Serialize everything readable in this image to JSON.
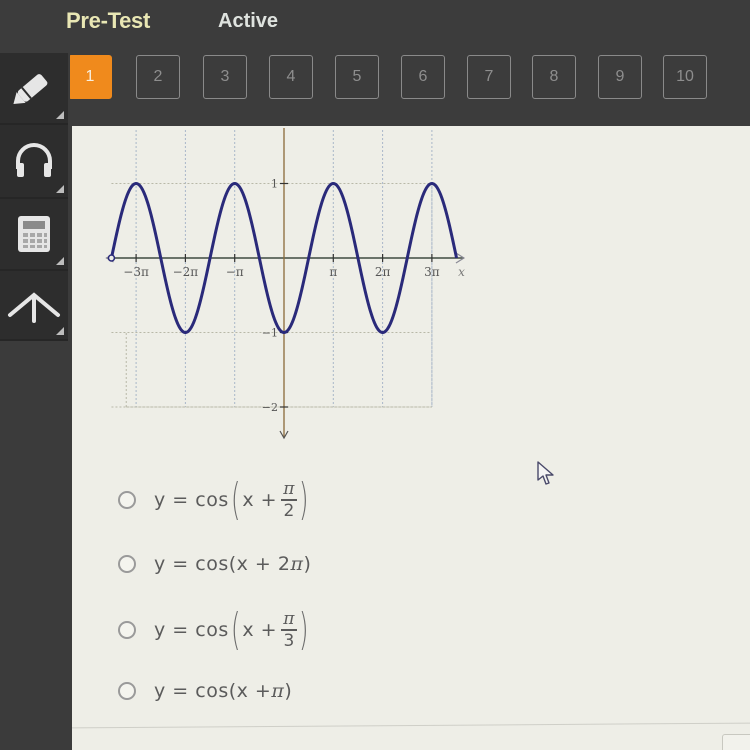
{
  "header": {
    "title": "Pre-Test",
    "status": "Active",
    "accent_color": "#f08a1c"
  },
  "question_nav": {
    "current": 1,
    "items": [
      "1",
      "2",
      "3",
      "4",
      "5",
      "6",
      "7",
      "8",
      "9",
      "10"
    ]
  },
  "sidebar": {
    "tools": [
      {
        "name": "pencil",
        "icon": "pencil-icon"
      },
      {
        "name": "audio",
        "icon": "headphones-icon"
      },
      {
        "name": "calculator",
        "icon": "calculator-icon"
      },
      {
        "name": "reference",
        "icon": "up-caret-icon"
      }
    ]
  },
  "graph": {
    "function_shown": "y = -cos(x)",
    "x_ticks": [
      "−3π",
      "−2π",
      "−π",
      "π",
      "2π",
      "3π"
    ],
    "x_tick_values": [
      -3,
      -2,
      -1,
      1,
      2,
      3
    ],
    "x_label": "x",
    "y_ticks": [
      "1",
      "−1",
      "−2"
    ],
    "y_tick_values": [
      1,
      -1,
      -2
    ],
    "x_range_pi": [
      -3.5,
      3.5
    ],
    "curve_color": "#2a2a7a"
  },
  "options": [
    {
      "prefix": "y = cos",
      "type": "fraction",
      "inner": "x +",
      "numerator": "π",
      "denominator": "2"
    },
    {
      "prefix": "y = cos(x + 2",
      "type": "inline",
      "pi": "π",
      "suffix": ")"
    },
    {
      "prefix": "y = cos",
      "type": "fraction",
      "inner": "x +",
      "numerator": "π",
      "denominator": "3"
    },
    {
      "prefix": "y = cos(x + ",
      "type": "inline",
      "pi": "π",
      "suffix": ")"
    }
  ]
}
